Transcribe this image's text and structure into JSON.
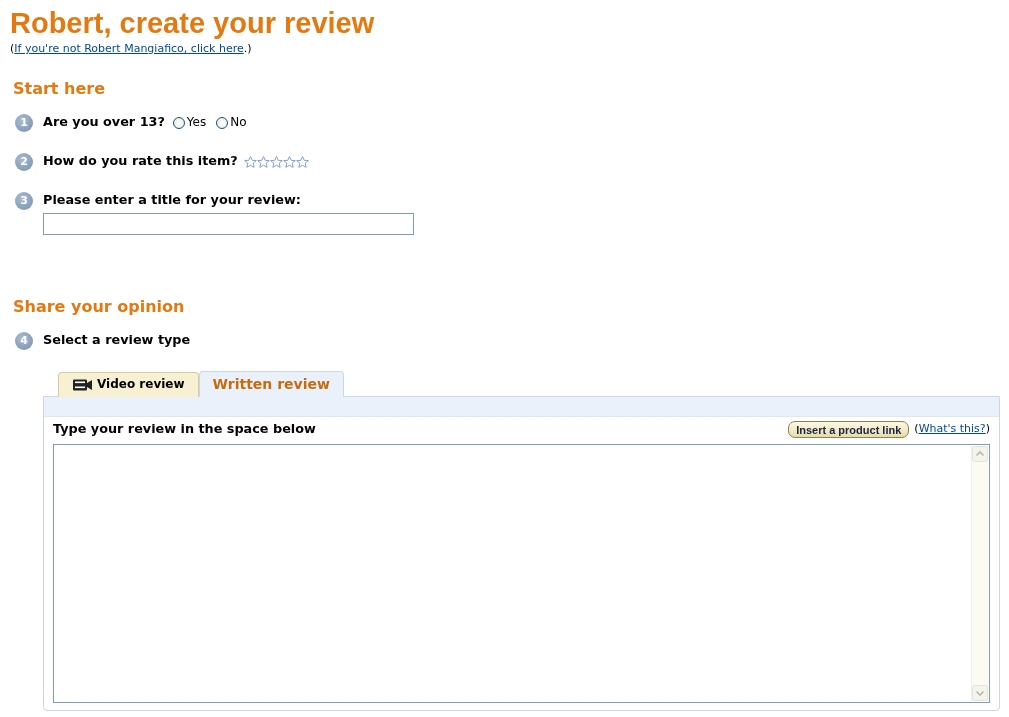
{
  "heading": "Robert, create your review",
  "identity_note": {
    "prefix": "(",
    "link": "If you're not Robert Mangiafico, click here",
    "suffix": ".)"
  },
  "sections": [
    {
      "title": "Start here",
      "steps": [
        {
          "number": "1",
          "kind": "radio",
          "label": "Are you over 13?",
          "options": [
            {
              "label": "Yes",
              "selected": false
            },
            {
              "label": "No",
              "selected": false
            }
          ]
        },
        {
          "number": "2",
          "kind": "rating",
          "label": "How do you rate this item?",
          "stars": 0
        },
        {
          "number": "3",
          "kind": "text",
          "label": "Please enter a title for your review:"
        }
      ]
    },
    {
      "title": "Share your opinion",
      "steps": [
        {
          "number": "4",
          "kind": "choice",
          "label": "Select a review type"
        }
      ]
    }
  ],
  "review_tabs": [
    {
      "label": "Video review",
      "kind": "video",
      "selected": false
    },
    {
      "label": "Written review",
      "kind": "written",
      "selected": true
    }
  ],
  "review_panel": {
    "prompt": "Type your review in the space below",
    "button": "Insert a product link",
    "help": {
      "prefix": "(",
      "link": "What's this?",
      "suffix": ")"
    }
  }
}
